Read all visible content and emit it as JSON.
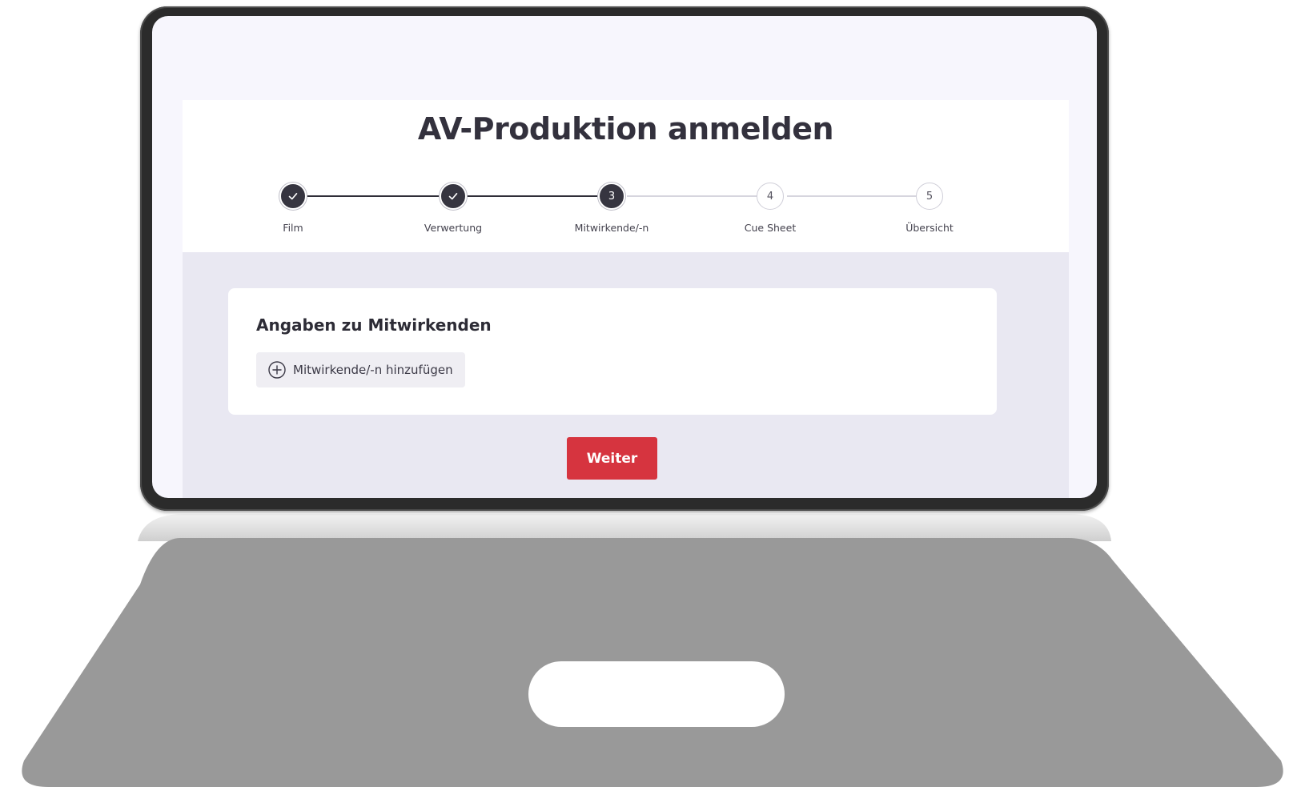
{
  "page": {
    "title": "AV-Produktion anmelden"
  },
  "stepper": {
    "steps": [
      {
        "number": "",
        "label": "Film",
        "state": "done"
      },
      {
        "number": "",
        "label": "Verwertung",
        "state": "done"
      },
      {
        "number": "3",
        "label": "Mitwirkende/-n",
        "state": "active"
      },
      {
        "number": "4",
        "label": "Cue Sheet",
        "state": "todo"
      },
      {
        "number": "5",
        "label": "Übersicht",
        "state": "todo"
      }
    ],
    "done_icon": "check-icon"
  },
  "card": {
    "title": "Angaben zu Mitwirkenden",
    "add_button_label": "Mitwirkende/-n hinzufügen",
    "add_icon": "plus-circle-icon"
  },
  "actions": {
    "next_label": "Weiter"
  },
  "colors": {
    "accent": "#d6343f",
    "step_dark": "#363540",
    "content_bg": "#e9e8f2",
    "screen_bg": "#f7f6fd"
  }
}
